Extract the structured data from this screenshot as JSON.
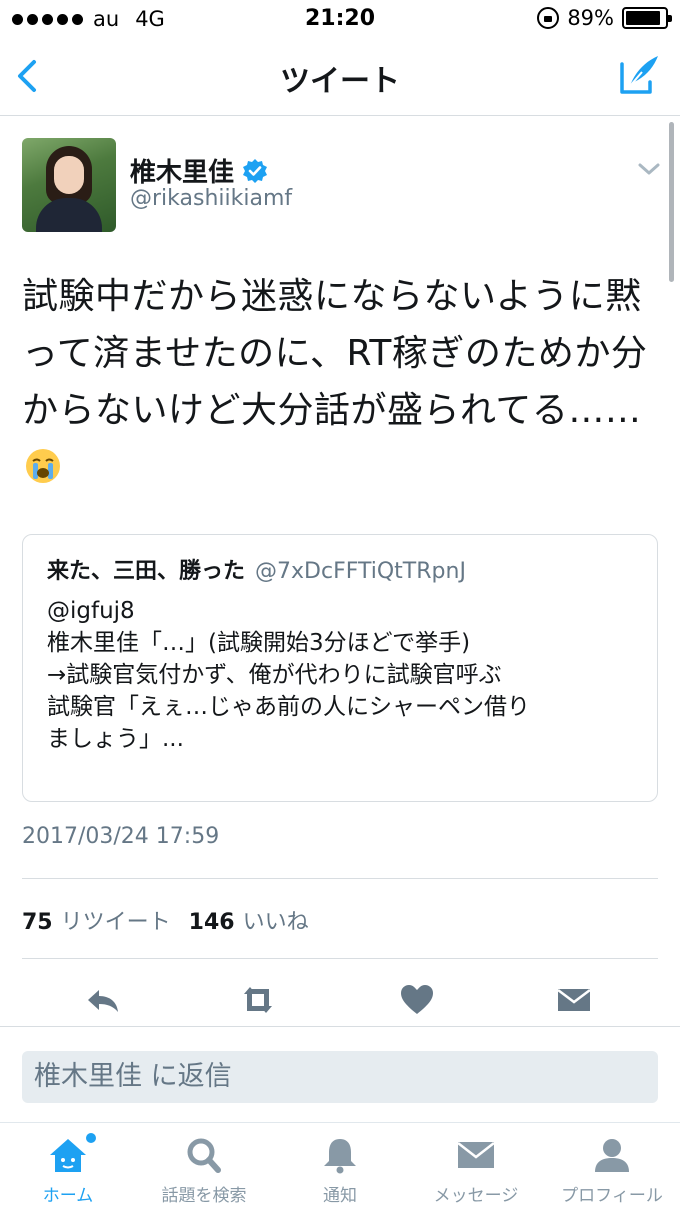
{
  "status_bar": {
    "carrier": "au",
    "network": "4G",
    "time": "21:20",
    "battery": "89%",
    "battery_level": 0.89
  },
  "nav": {
    "title": "ツイート"
  },
  "tweet": {
    "author_name": "椎木里佳",
    "author_handle": "@rikashiikiamf",
    "text": "試験中だから迷惑にならないように黙って済ませたのに、RT稼ぎのためか分からないけど大分話が盛られてる……",
    "timestamp": "2017/03/24 17:59",
    "retweet_count": "75",
    "retweet_label": "リツイート",
    "like_count": "146",
    "like_label": "いいね"
  },
  "quote": {
    "name": "来た、三田、勝った",
    "handle": "@7xDcFFTiQtTRpnJ",
    "lines": [
      "@igfuj8",
      "椎木里佳「…」(試験開始3分ほどで挙手)",
      "→試験官気付かず、俺が代わりに試験官呼ぶ",
      "試験官「えぇ…じゃあ前の人にシャーペン借り",
      "ましょう」..."
    ]
  },
  "reply": {
    "placeholder": "椎木里佳 に返信"
  },
  "tabs": [
    {
      "label": "ホーム",
      "icon": "home-icon"
    },
    {
      "label": "話題を検索",
      "icon": "search-icon"
    },
    {
      "label": "通知",
      "icon": "bell-icon"
    },
    {
      "label": "メッセージ",
      "icon": "mail-icon"
    },
    {
      "label": "プロフィール",
      "icon": "person-icon"
    }
  ],
  "colors": {
    "accent": "#1da1f2",
    "muted": "#657786",
    "icon_gray": "#8899a6"
  }
}
